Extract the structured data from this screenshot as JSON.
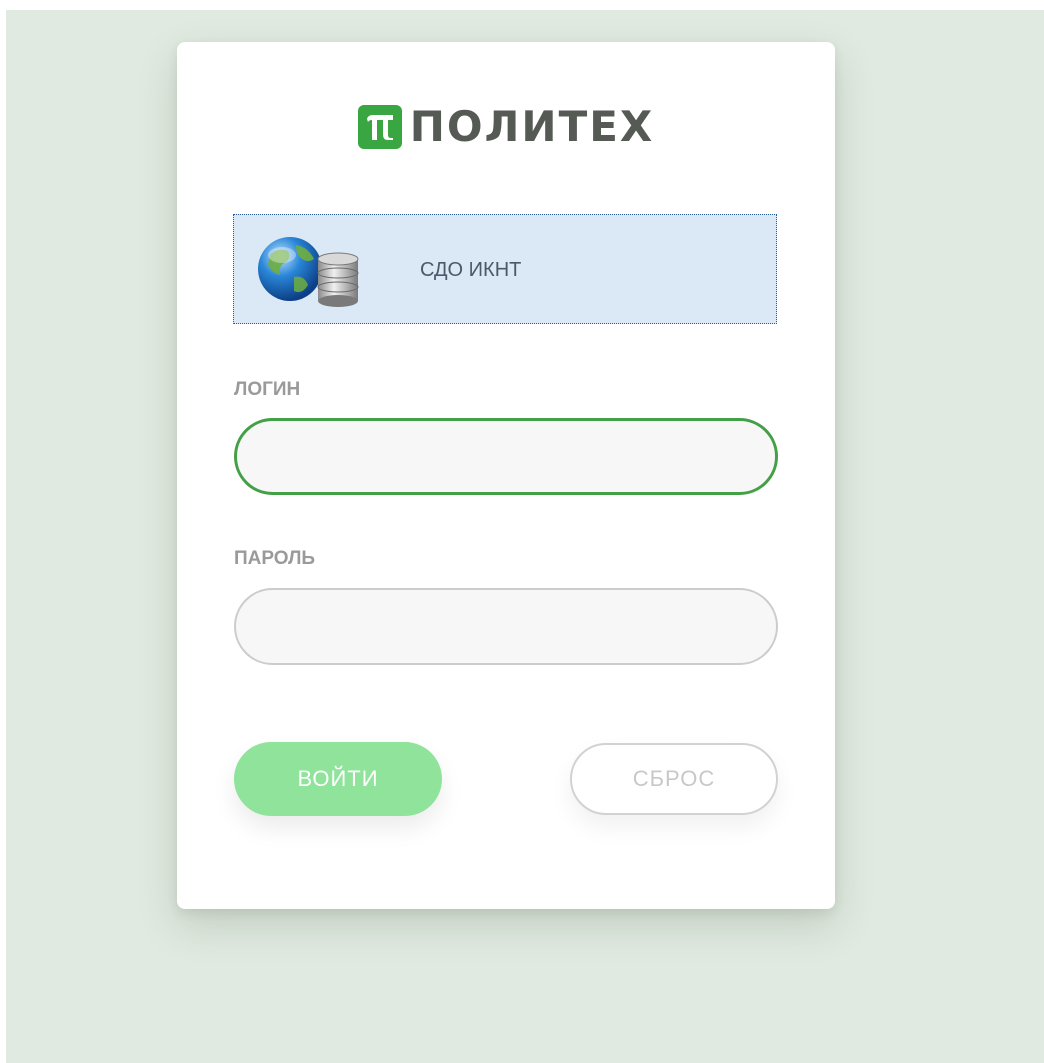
{
  "logo": {
    "mark_glyph": "π",
    "text": "ПОЛИТЕХ",
    "brand_color": "#3aa641"
  },
  "service": {
    "label": "СДО ИКНТ",
    "icon": "globe-database-icon"
  },
  "form": {
    "login": {
      "label": "ЛОГИН",
      "value": ""
    },
    "password": {
      "label": "ПАРОЛЬ",
      "value": ""
    },
    "submit_label": "ВОЙТИ",
    "reset_label": "СБРОС"
  },
  "colors": {
    "background": "#e0eae0",
    "accent": "#43a047",
    "submit_button": "#8fe39a"
  }
}
